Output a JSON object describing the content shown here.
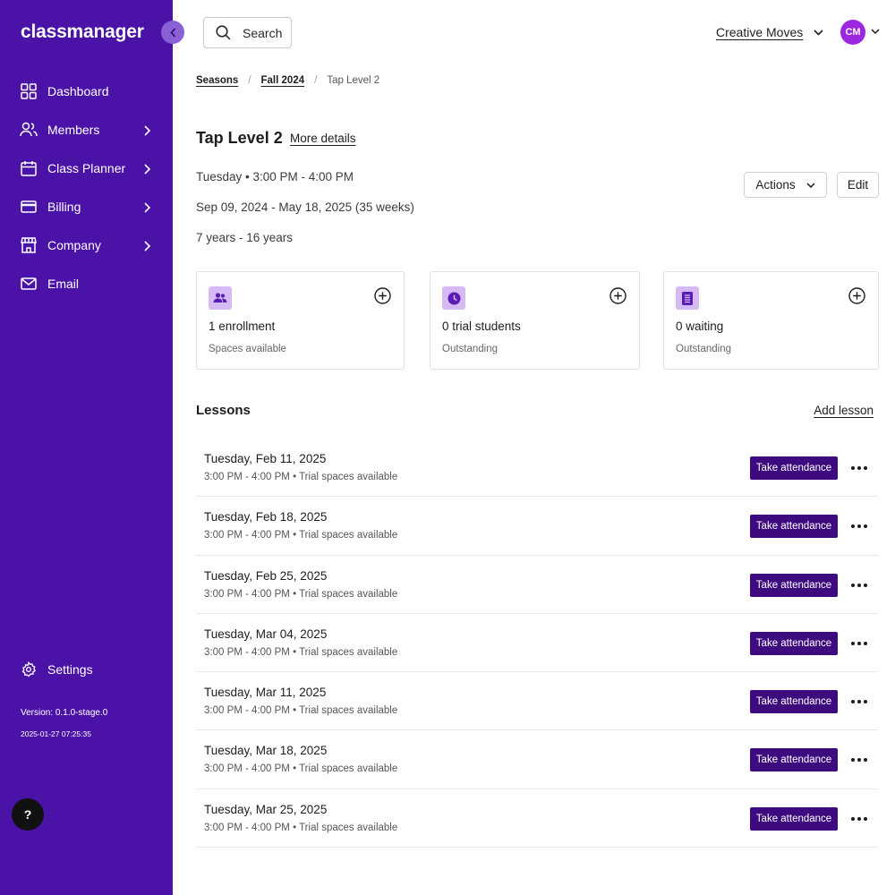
{
  "app": {
    "logo": "classmanager",
    "org_name": "Creative Moves",
    "user_initials": "CM"
  },
  "sidebar": {
    "items": [
      {
        "label": "Dashboard"
      },
      {
        "label": "Members"
      },
      {
        "label": "Class Planner"
      },
      {
        "label": "Billing"
      },
      {
        "label": "Company"
      },
      {
        "label": "Email"
      }
    ],
    "settings_label": "Settings",
    "version": "Version: 0.1.0-stage.0",
    "build_timestamp": "2025-01-27 07:25:35",
    "help_label": "?"
  },
  "header": {
    "search_label": "Search"
  },
  "breadcrumb": {
    "seasons": "Seasons",
    "season": "Fall 2024",
    "current": "Tap Level 2",
    "separator": "/"
  },
  "class": {
    "title": "Tap Level 2",
    "more_details": "More details",
    "schedule": "Tuesday • 3:00 PM - 4:00 PM",
    "date_range": "Sep 09, 2024 - May 18, 2025 (35 weeks)",
    "age_range": "7 years - 16 years",
    "actions_label": "Actions",
    "edit_label": "Edit"
  },
  "stats": [
    {
      "title": "1 enrollment",
      "subtitle": "Spaces available",
      "icon": "people-icon"
    },
    {
      "title": "0 trial students",
      "subtitle": "Outstanding",
      "icon": "clock-icon"
    },
    {
      "title": "0 waiting",
      "subtitle": "Outstanding",
      "icon": "list-icon"
    }
  ],
  "lessons": {
    "title": "Lessons",
    "add_label": "Add lesson",
    "action_label": "Take attendance",
    "rows": [
      {
        "date": "Tuesday, Feb 11, 2025",
        "meta": "3:00 PM - 4:00 PM • Trial spaces available"
      },
      {
        "date": "Tuesday, Feb 18, 2025",
        "meta": "3:00 PM - 4:00 PM • Trial spaces available"
      },
      {
        "date": "Tuesday, Feb 25, 2025",
        "meta": "3:00 PM - 4:00 PM • Trial spaces available"
      },
      {
        "date": "Tuesday, Mar 04, 2025",
        "meta": "3:00 PM - 4:00 PM • Trial spaces available"
      },
      {
        "date": "Tuesday, Mar 11, 2025",
        "meta": "3:00 PM - 4:00 PM • Trial spaces available"
      },
      {
        "date": "Tuesday, Mar 18, 2025",
        "meta": "3:00 PM - 4:00 PM • Trial spaces available"
      },
      {
        "date": "Tuesday, Mar 25, 2025",
        "meta": "3:00 PM - 4:00 PM • Trial spaces available"
      }
    ]
  },
  "colors": {
    "sidebar": "#4b12a8",
    "primary_button": "#3d0b7e",
    "avatar": "#9b27e0",
    "icon_tile": "#d6baf4"
  }
}
